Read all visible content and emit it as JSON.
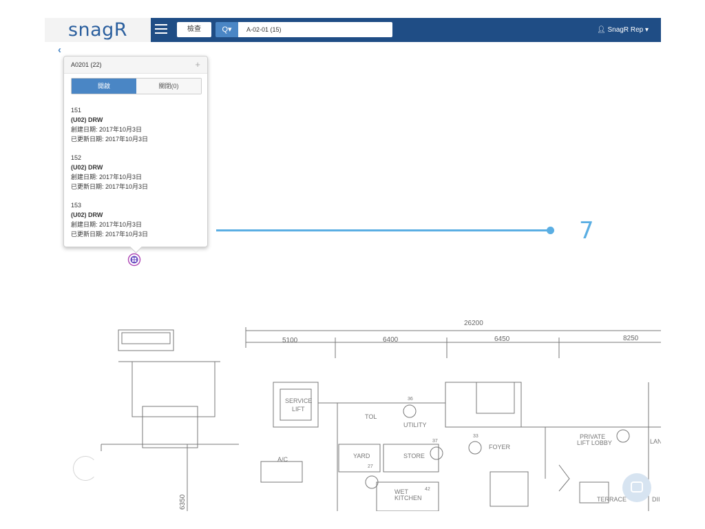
{
  "header": {
    "logo": "snagR",
    "type_select": "檢查",
    "search_button": "Q▾",
    "search_value": "A-02-01 (15)",
    "user": "SnagR Rep ▾"
  },
  "popover": {
    "title": "A0201 (22)",
    "add": "+",
    "tab_open": "開啟",
    "tab_closed": "關閉(0)",
    "issues": [
      {
        "id": "151",
        "name": "(U02) DRW",
        "created": "創建日期: 2017年10月3日",
        "updated": "已更新日期: 2017年10月3日"
      },
      {
        "id": "152",
        "name": "(U02) DRW",
        "created": "創建日期: 2017年10月3日",
        "updated": "已更新日期: 2017年10月3日"
      },
      {
        "id": "153",
        "name": "(U02) DRW",
        "created": "創建日期: 2017年10月3日",
        "updated": "已更新日期: 2017年10月3日"
      }
    ]
  },
  "slider": {
    "value": "7"
  },
  "plan": {
    "dims": [
      "26200",
      "5100",
      "6400",
      "6450",
      "8250",
      "6350"
    ],
    "rooms": [
      "SERVICE",
      "LIFT",
      "TOL",
      "UTILITY",
      "YARD",
      "STORE",
      "FOYER",
      "PRIVATE",
      "LIFT LOBBY",
      "LAN",
      "A/C",
      "WET",
      "KITCHEN",
      "TERRACE",
      "DII"
    ],
    "numbers": [
      "36",
      "37",
      "27",
      "33",
      "42"
    ]
  },
  "colors": {
    "navbar": "#1f4d85",
    "accent": "#4a86c5",
    "slider": "#5aaee3"
  }
}
